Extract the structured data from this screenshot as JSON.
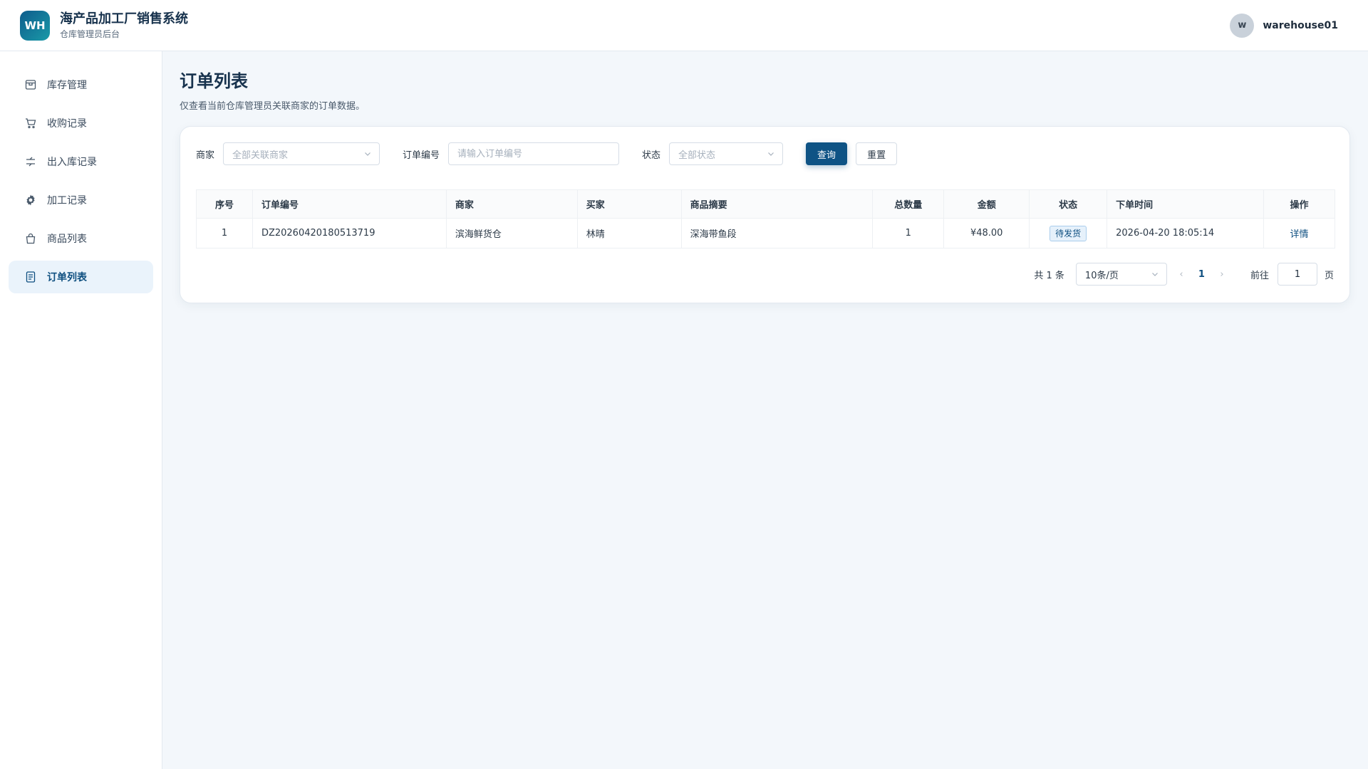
{
  "header": {
    "logo_text": "WH",
    "title": "海产品加工厂销售系统",
    "subtitle": "仓库管理员后台",
    "avatar_letter": "w",
    "username": "warehouse01"
  },
  "sidebar": {
    "items": [
      {
        "label": "库存管理",
        "icon": "box-icon"
      },
      {
        "label": "收购记录",
        "icon": "cart-icon"
      },
      {
        "label": "出入库记录",
        "icon": "transfer-icon"
      },
      {
        "label": "加工记录",
        "icon": "gear-icon"
      },
      {
        "label": "商品列表",
        "icon": "bag-icon"
      },
      {
        "label": "订单列表",
        "icon": "document-icon",
        "active": true
      }
    ]
  },
  "page": {
    "title": "订单列表",
    "description": "仅查看当前仓库管理员关联商家的订单数据。"
  },
  "filters": {
    "merchant_label": "商家",
    "merchant_placeholder": "全部关联商家",
    "order_no_label": "订单编号",
    "order_no_placeholder": "请输入订单编号",
    "status_label": "状态",
    "status_placeholder": "全部状态",
    "query_button": "查询",
    "reset_button": "重置"
  },
  "table": {
    "columns": [
      "序号",
      "订单编号",
      "商家",
      "买家",
      "商品摘要",
      "总数量",
      "金额",
      "状态",
      "下单时间",
      "操作"
    ],
    "rows": [
      {
        "index": "1",
        "order_no": "DZ20260420180513719",
        "merchant": "滨海鲜货仓",
        "buyer": "林晴",
        "summary": "深海带鱼段",
        "quantity": "1",
        "amount": "¥48.00",
        "status": "待发货",
        "time": "2026-04-20 18:05:14",
        "action": "详情"
      }
    ]
  },
  "pagination": {
    "total_text": "共 1 条",
    "page_size": "10条/页",
    "current_page": "1",
    "goto_label": "前往",
    "goto_value": "1",
    "page_unit": "页"
  },
  "colors": {
    "primary": "#0e5385",
    "active_nav_bg": "#eaf3fb",
    "page_bg": "#f3f7fb"
  }
}
